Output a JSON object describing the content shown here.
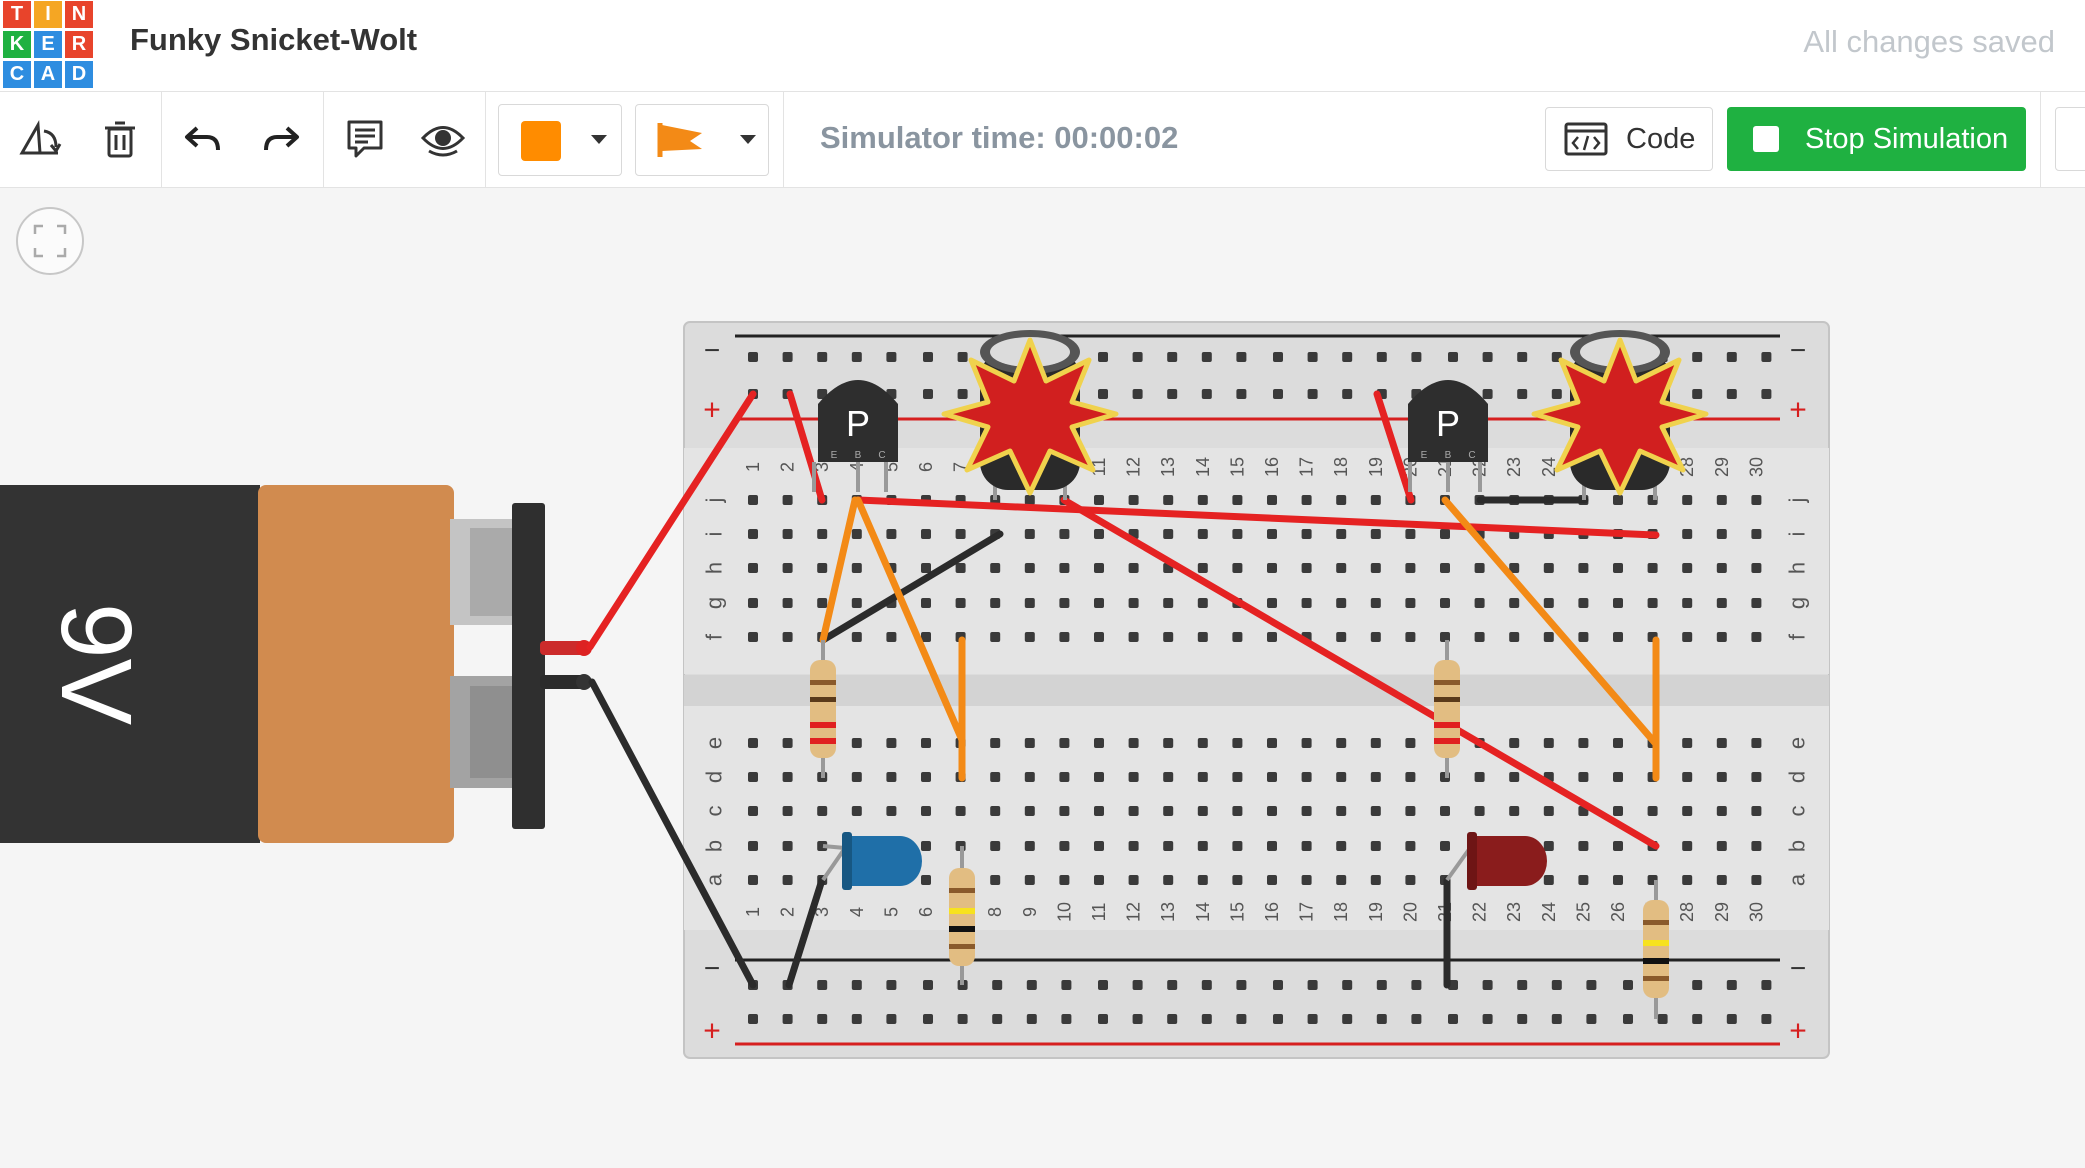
{
  "logo": {
    "letters": [
      {
        "ch": "T",
        "color": "#e8442b"
      },
      {
        "ch": "I",
        "color": "#f5a623"
      },
      {
        "ch": "N",
        "color": "#e8442b"
      },
      {
        "ch": "K",
        "color": "#1fb141"
      },
      {
        "ch": "E",
        "color": "#2e8de0"
      },
      {
        "ch": "R",
        "color": "#e8442b"
      },
      {
        "ch": "C",
        "color": "#2e8de0"
      },
      {
        "ch": "A",
        "color": "#2e8de0"
      },
      {
        "ch": "D",
        "color": "#2e8de0"
      }
    ]
  },
  "header": {
    "title": "Funky Snicket-Wolt",
    "save_status": "All changes saved"
  },
  "toolbar": {
    "icons": [
      "rotate-icon",
      "delete-icon",
      "undo-icon",
      "redo-icon",
      "notes-icon",
      "visibility-icon"
    ],
    "color_swatch": "#ff8c00",
    "simulator_time": "Simulator time: 00:00:02",
    "code_label": "Code",
    "stop_label": "Stop Simulation",
    "accent": "#1fb141"
  },
  "battery": {
    "label": "9V"
  },
  "breadboard": {
    "columns": [
      "1",
      "2",
      "3",
      "4",
      "5",
      "6",
      "7",
      "8",
      "9",
      "10",
      "11",
      "12",
      "13",
      "14",
      "15",
      "16",
      "17",
      "18",
      "19",
      "20",
      "21",
      "22",
      "23",
      "24",
      "25",
      "26",
      "27",
      "28",
      "29",
      "30"
    ],
    "rows_top": [
      "j",
      "i",
      "h",
      "g",
      "f"
    ],
    "rows_bottom": [
      "e",
      "d",
      "c",
      "b",
      "a"
    ],
    "rail_minus": "−",
    "rail_plus": "+"
  },
  "components": {
    "transistor_label": "P",
    "transistor_pins": [
      "E",
      "B",
      "C"
    ],
    "led_left_color": "#1f6fa8",
    "led_right_color": "#8a1c1c",
    "wire_red": "#e52222",
    "wire_orange": "#f38a16",
    "wire_black": "#2b2b2b"
  }
}
